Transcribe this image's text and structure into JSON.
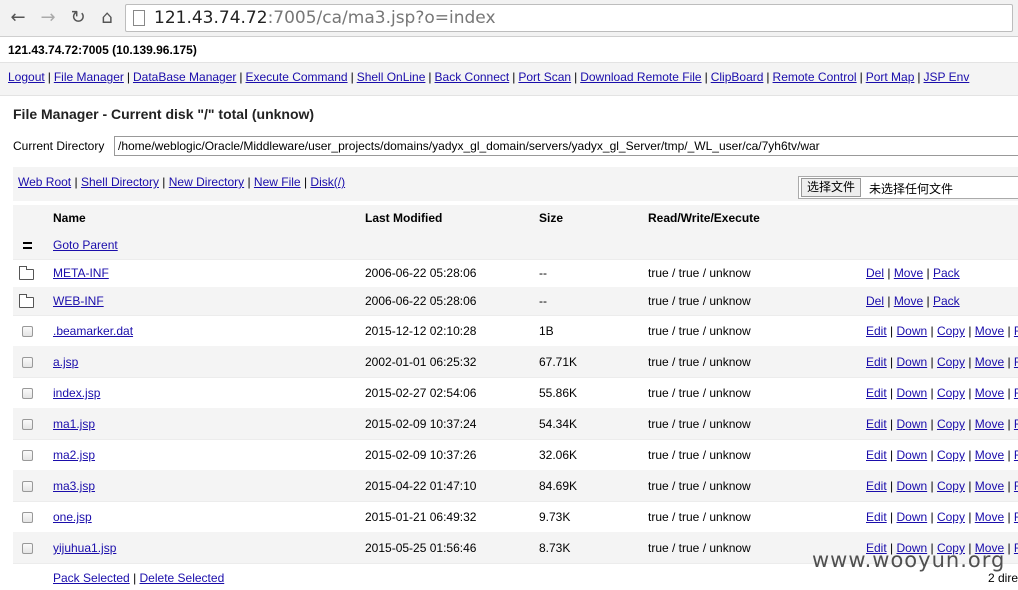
{
  "browser": {
    "url_host": "121.43.74.72",
    "url_rest": ":7005/ca/ma3.jsp?o=index",
    "back_icon": "←",
    "forward_icon": "→",
    "reload_icon": "↻",
    "home_icon": "⌂"
  },
  "host_line": "121.43.74.72:7005 (10.139.96.175)",
  "menu": [
    "Logout",
    "File Manager",
    "DataBase Manager",
    "Execute Command",
    "Shell OnLine",
    "Back Connect",
    "Port Scan",
    "Download Remote File",
    "ClipBoard",
    "Remote Control",
    "Port Map",
    "JSP Env"
  ],
  "file_manager": {
    "title": "File Manager - Current disk \"/\" total (unknow)",
    "current_dir_label": "Current Directory",
    "current_dir_value": "/home/weblogic/Oracle/Middleware/user_projects/domains/yadyx_gl_domain/servers/yadyx_gl_Server/tmp/_WL_user/ca/7yh6tv/war",
    "actions": [
      "Web Root",
      "Shell Directory",
      "New Directory",
      "New File",
      "Disk(/)"
    ],
    "upload_button": "选择文件",
    "upload_status": "未选择任何文件"
  },
  "table": {
    "headers": {
      "name": "Name",
      "modified": "Last Modified",
      "size": "Size",
      "rwx": "Read/Write/Execute"
    },
    "goto_parent": "Goto Parent",
    "dir_ops": [
      "Del",
      "Move",
      "Pack"
    ],
    "file_ops": [
      "Edit",
      "Down",
      "Copy",
      "Move",
      "R"
    ],
    "rows": [
      {
        "type": "dir",
        "name": "META-INF",
        "modified": "2006-06-22 05:28:06",
        "size": "--",
        "rwx": "true / true / unknow"
      },
      {
        "type": "dir",
        "name": "WEB-INF",
        "modified": "2006-06-22 05:28:06",
        "size": "--",
        "rwx": "true / true / unknow"
      },
      {
        "type": "file",
        "name": ".beamarker.dat",
        "modified": "2015-12-12 02:10:28",
        "size": "1B",
        "rwx": "true / true / unknow"
      },
      {
        "type": "file",
        "name": "a.jsp",
        "modified": "2002-01-01 06:25:32",
        "size": "67.71K",
        "rwx": "true / true / unknow"
      },
      {
        "type": "file",
        "name": "index.jsp",
        "modified": "2015-02-27 02:54:06",
        "size": "55.86K",
        "rwx": "true / true / unknow"
      },
      {
        "type": "file",
        "name": "ma1.jsp",
        "modified": "2015-02-09 10:37:24",
        "size": "54.34K",
        "rwx": "true / true / unknow"
      },
      {
        "type": "file",
        "name": "ma2.jsp",
        "modified": "2015-02-09 10:37:26",
        "size": "32.06K",
        "rwx": "true / true / unknow"
      },
      {
        "type": "file",
        "name": "ma3.jsp",
        "modified": "2015-04-22 01:47:10",
        "size": "84.69K",
        "rwx": "true / true / unknow"
      },
      {
        "type": "file",
        "name": "one.jsp",
        "modified": "2015-01-21 06:49:32",
        "size": "9.73K",
        "rwx": "true / true / unknow"
      },
      {
        "type": "file",
        "name": "yijuhua1.jsp",
        "modified": "2015-05-25 01:56:46",
        "size": "8.73K",
        "rwx": "true / true / unknow"
      }
    ],
    "pack_selected": "Pack Selected",
    "delete_selected": "Delete Selected",
    "summary": "2 dire"
  },
  "watermark": "www.wooyun.org"
}
